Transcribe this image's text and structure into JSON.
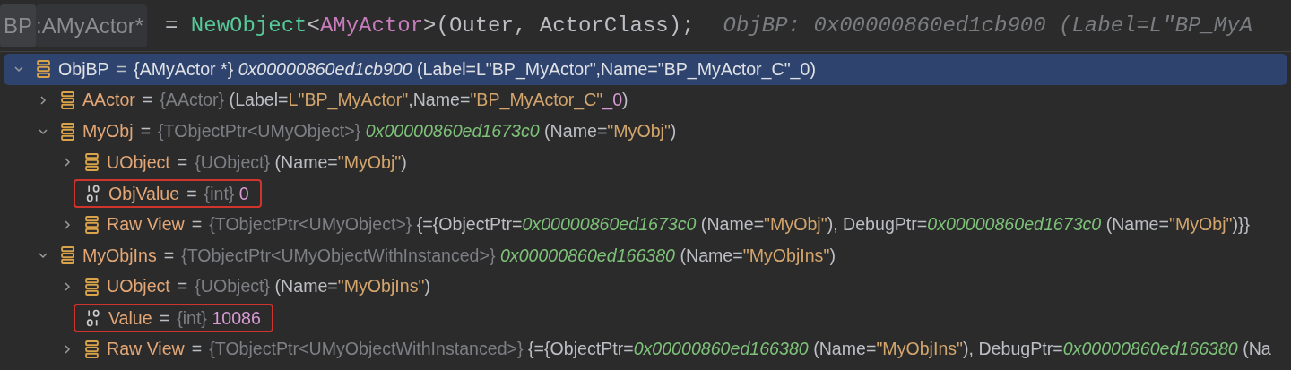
{
  "code_line": {
    "tokens": [
      {
        "kind": "hint_box",
        "text": "BP"
      },
      {
        "kind": "hint",
        "text": ":AMyActor*"
      },
      {
        "kind": "plain",
        "text": "= "
      },
      {
        "kind": "function",
        "text": "NewObject"
      },
      {
        "kind": "plain",
        "text": "<"
      },
      {
        "kind": "type",
        "text": "AMyActor"
      },
      {
        "kind": "plain",
        "text": ">(Outer, ActorClass);"
      },
      {
        "kind": "inline_value",
        "text": "ObjBP: 0x00000860ed1cb900 (Label=L\"BP_MyA"
      }
    ]
  },
  "variables": [
    {
      "name": "ObjBP",
      "operator": "=",
      "kind": "object",
      "expanded": true,
      "selected": true,
      "boxed": false,
      "type": "{AMyActor *}",
      "value": [
        {
          "kind": "address",
          "text": "0x00000860ed1cb900"
        },
        {
          "kind": "text",
          "text": " (Label=L\"BP_MyActor\",Name=\"BP_MyActor_C\"_0)"
        }
      ],
      "children": [
        {
          "name": "AActor",
          "operator": "=",
          "kind": "object",
          "expanded": false,
          "selected": false,
          "boxed": false,
          "type": "{AActor}",
          "value": [
            {
              "kind": "text",
              "text": "(Label="
            },
            {
              "kind": "string",
              "text": "L\"BP_MyActor\""
            },
            {
              "kind": "text",
              "text": ",Name="
            },
            {
              "kind": "string",
              "text": "\"BP_MyActor_C\""
            },
            {
              "kind": "number",
              "text": "_0"
            },
            {
              "kind": "text",
              "text": ")"
            }
          ]
        },
        {
          "name": "MyObj",
          "operator": "=",
          "kind": "object",
          "expanded": true,
          "selected": false,
          "boxed": false,
          "type": "{TObjectPtr<UMyObject>}",
          "value": [
            {
              "kind": "address",
              "text": "0x00000860ed1673c0"
            },
            {
              "kind": "text",
              "text": " (Name="
            },
            {
              "kind": "string",
              "text": "\"MyObj\""
            },
            {
              "kind": "text",
              "text": ")"
            }
          ],
          "children": [
            {
              "name": "UObject",
              "operator": "=",
              "kind": "object",
              "expanded": false,
              "selected": false,
              "boxed": false,
              "type": "{UObject}",
              "value": [
                {
                  "kind": "text",
                  "text": "(Name="
                },
                {
                  "kind": "string",
                  "text": "\"MyObj\""
                },
                {
                  "kind": "text",
                  "text": ")"
                }
              ]
            },
            {
              "name": "ObjValue",
              "operator": "=",
              "kind": "int",
              "selected": false,
              "boxed": true,
              "type": "{int}",
              "value": [
                {
                  "kind": "number",
                  "text": "0"
                }
              ]
            },
            {
              "name": "Raw View",
              "operator": "=",
              "kind": "object",
              "expanded": false,
              "selected": false,
              "boxed": false,
              "type": "{TObjectPtr<UMyObject>}",
              "value": [
                {
                  "kind": "text",
                  "text": "{={ObjectPtr="
                },
                {
                  "kind": "address",
                  "text": "0x00000860ed1673c0"
                },
                {
                  "kind": "text",
                  "text": " (Name="
                },
                {
                  "kind": "string",
                  "text": "\"MyObj\""
                },
                {
                  "kind": "text",
                  "text": "), DebugPtr="
                },
                {
                  "kind": "address",
                  "text": "0x00000860ed1673c0"
                },
                {
                  "kind": "text",
                  "text": " (Name="
                },
                {
                  "kind": "string",
                  "text": "\"MyObj\""
                },
                {
                  "kind": "text",
                  "text": ")}}"
                }
              ]
            }
          ]
        },
        {
          "name": "MyObjIns",
          "operator": "=",
          "kind": "object",
          "expanded": true,
          "selected": false,
          "boxed": false,
          "type": "{TObjectPtr<UMyObjectWithInstanced>}",
          "value": [
            {
              "kind": "address",
              "text": "0x00000860ed166380"
            },
            {
              "kind": "text",
              "text": " (Name="
            },
            {
              "kind": "string",
              "text": "\"MyObjIns\""
            },
            {
              "kind": "text",
              "text": ")"
            }
          ],
          "children": [
            {
              "name": "UObject",
              "operator": "=",
              "kind": "object",
              "expanded": false,
              "selected": false,
              "boxed": false,
              "type": "{UObject}",
              "value": [
                {
                  "kind": "text",
                  "text": "(Name="
                },
                {
                  "kind": "string",
                  "text": "\"MyObjIns\""
                },
                {
                  "kind": "text",
                  "text": ")"
                }
              ]
            },
            {
              "name": "Value",
              "operator": "=",
              "kind": "int",
              "selected": false,
              "boxed": true,
              "type": "{int}",
              "value": [
                {
                  "kind": "number",
                  "text": "10086"
                }
              ]
            },
            {
              "name": "Raw View",
              "operator": "=",
              "kind": "object",
              "expanded": false,
              "selected": false,
              "boxed": false,
              "type": "{TObjectPtr<UMyObjectWithInstanced>}",
              "value": [
                {
                  "kind": "text",
                  "text": "{={ObjectPtr="
                },
                {
                  "kind": "address",
                  "text": "0x00000860ed166380"
                },
                {
                  "kind": "text",
                  "text": " (Name="
                },
                {
                  "kind": "string",
                  "text": "\"MyObjIns\""
                },
                {
                  "kind": "text",
                  "text": "), DebugPtr="
                },
                {
                  "kind": "address",
                  "text": "0x00000860ed166380"
                },
                {
                  "kind": "text",
                  "text": " (Na"
                }
              ]
            }
          ]
        }
      ]
    }
  ]
}
